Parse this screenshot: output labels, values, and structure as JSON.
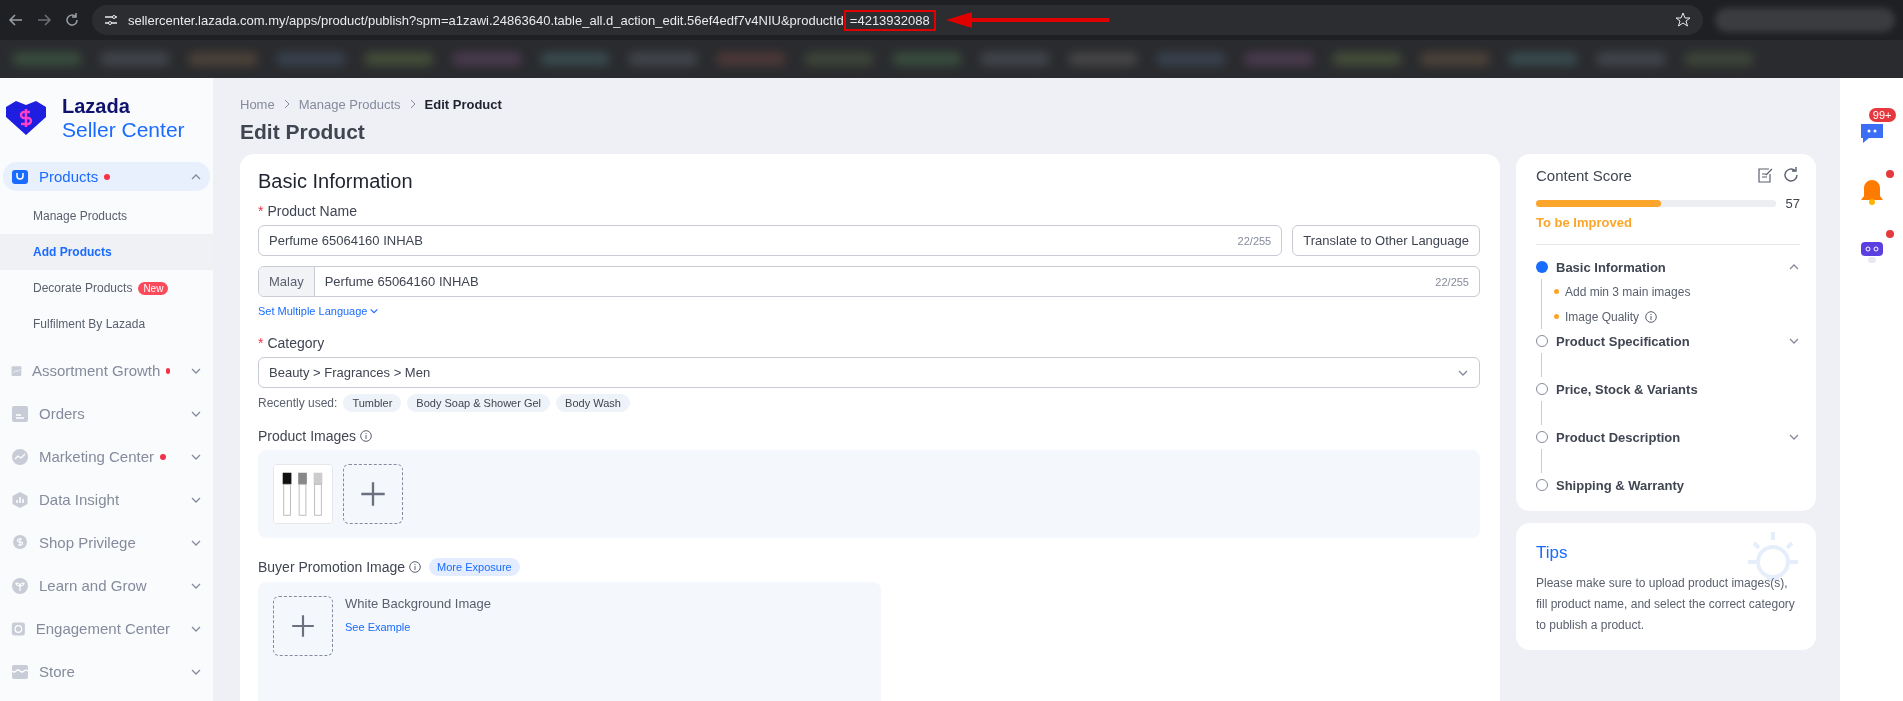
{
  "browser": {
    "url": "sellercenter.lazada.com.my/apps/product/publish?spm=a1zawi.24863640.table_all.d_action_edit.56ef4edf7v4NIU&productId",
    "url_highlight": "=4213932088"
  },
  "sidebar": {
    "logo": {
      "line1": "Lazada",
      "line2": "Seller Center"
    },
    "items": [
      {
        "label": "Products",
        "dot": true,
        "selected": true,
        "expanded": true,
        "children": [
          {
            "label": "Manage Products",
            "selected": false
          },
          {
            "label": "Add Products",
            "selected": true
          },
          {
            "label": "Decorate Products",
            "selected": false,
            "badge": "New"
          },
          {
            "label": "Fulfilment By Lazada",
            "selected": false
          }
        ]
      },
      {
        "label": "Assortment Growth",
        "dot": true,
        "selected": false,
        "expanded": false
      },
      {
        "label": "Orders",
        "dot": false,
        "selected": false,
        "expanded": false
      },
      {
        "label": "Marketing Center",
        "dot": true,
        "selected": false,
        "expanded": false
      },
      {
        "label": "Data Insight",
        "dot": false,
        "selected": false,
        "expanded": false
      },
      {
        "label": "Shop Privilege",
        "dot": false,
        "selected": false,
        "expanded": false
      },
      {
        "label": "Learn and Grow",
        "dot": false,
        "selected": false,
        "expanded": false
      },
      {
        "label": "Engagement Center",
        "dot": false,
        "selected": false,
        "expanded": false
      },
      {
        "label": "Store",
        "dot": false,
        "selected": false,
        "expanded": false
      }
    ]
  },
  "breadcrumb": [
    "Home",
    "Manage Products",
    "Edit Product"
  ],
  "title": "Edit Product",
  "form": {
    "section_title": "Basic Information",
    "product_name": {
      "label": "Product Name",
      "required_mark": "*",
      "value": "Perfume 65064160 INHAB",
      "counter": "22/255"
    },
    "translate_button": "Translate to Other Language",
    "malay": {
      "prefix": "Malay",
      "value": "Perfume 65064160 INHAB",
      "counter": "22/255"
    },
    "set_multiple_language": "Set Multiple Language",
    "category": {
      "label": "Category",
      "required_mark": "*",
      "value": "Beauty > Fragrances > Men"
    },
    "recently_used": {
      "label": "Recently used:",
      "tags": [
        "Tumbler",
        "Body Soap & Shower Gel",
        "Body Wash"
      ]
    },
    "product_images": {
      "label": "Product Images"
    },
    "buyer_promotion": {
      "label": "Buyer Promotion Image",
      "badge": "More Exposure",
      "item_title": "White Background Image",
      "link": "See Example"
    }
  },
  "content_score": {
    "title": "Content Score",
    "level": 0.52,
    "score": "57",
    "status": "To be Improved",
    "steps": [
      {
        "label": "Basic Information",
        "selected": true,
        "expanded": true,
        "hints": [
          "Add min 3 main images",
          "Image Quality"
        ]
      },
      {
        "label": "Product Specification",
        "selected": false,
        "expanded": false
      },
      {
        "label": "Price, Stock & Variants",
        "selected": false
      },
      {
        "label": "Product Description",
        "selected": false,
        "expanded": false
      },
      {
        "label": "Shipping & Warranty",
        "selected": false
      }
    ]
  },
  "tips": {
    "title": "Tips",
    "text": "Please make sure to upload product images(s), fill product name, and select the correct category to publish a product."
  },
  "rail": {
    "chat_badge": "99+",
    "bell_dot": true,
    "robot_dot": true
  }
}
